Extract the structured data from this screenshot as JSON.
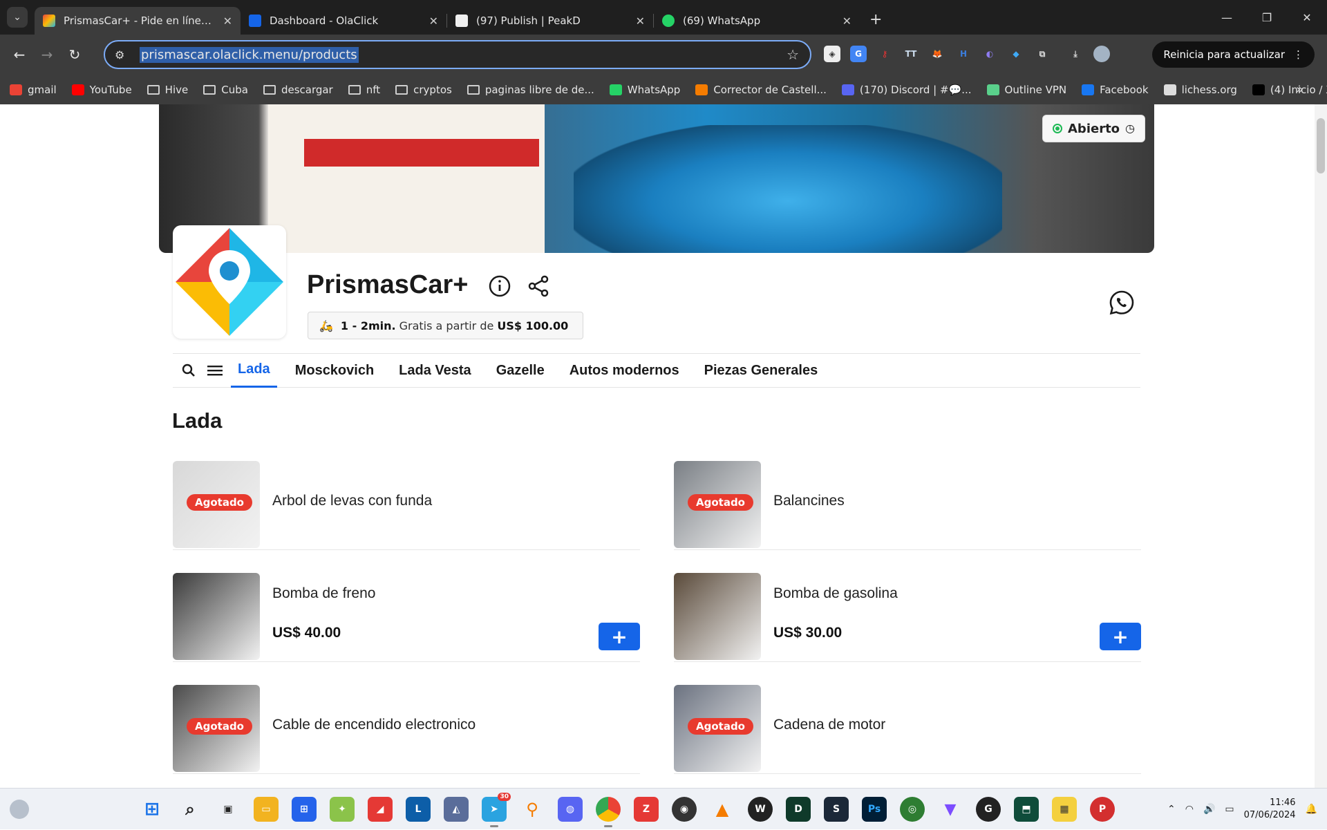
{
  "browser": {
    "tabs": [
      {
        "title": "PrismasCar+ - Pide en línea. Me",
        "favicon_color": "#e8453c",
        "active": true
      },
      {
        "title": "Dashboard - OlaClick",
        "favicon_color": "#1565e8",
        "active": false
      },
      {
        "title": "(97) Publish | PeakD",
        "favicon_color": "#f0f0f0",
        "active": false
      },
      {
        "title": "(69) WhatsApp",
        "favicon_color": "#25d366",
        "active": false
      }
    ],
    "address": "prismascar.olaclick.menu/products",
    "update_button": "Reinicia para actualizar",
    "bookmarks": [
      {
        "label": "gmail",
        "icon": "gmail-icon",
        "type": "icon",
        "color": "#ea4335"
      },
      {
        "label": "YouTube",
        "icon": "youtube-icon",
        "type": "icon",
        "color": "#ff0000"
      },
      {
        "label": "Hive",
        "icon": "folder-icon",
        "type": "folder"
      },
      {
        "label": "Cuba",
        "icon": "folder-icon",
        "type": "folder"
      },
      {
        "label": "descargar",
        "icon": "folder-icon",
        "type": "folder"
      },
      {
        "label": "nft",
        "icon": "folder-icon",
        "type": "folder"
      },
      {
        "label": "cryptos",
        "icon": "folder-icon",
        "type": "folder"
      },
      {
        "label": "paginas libre de de...",
        "icon": "folder-icon",
        "type": "folder"
      },
      {
        "label": "WhatsApp",
        "icon": "whatsapp-icon",
        "type": "icon",
        "color": "#25d366"
      },
      {
        "label": "Corrector de Castell...",
        "icon": "check-icon",
        "type": "icon",
        "color": "#f57c00"
      },
      {
        "label": "(170) Discord | #💬...",
        "icon": "discord-icon",
        "type": "icon",
        "color": "#5865f2"
      },
      {
        "label": "Outline VPN",
        "icon": "outline-icon",
        "type": "icon",
        "color": "#5ad08b"
      },
      {
        "label": "Facebook",
        "icon": "facebook-icon",
        "type": "icon",
        "color": "#1877f2"
      },
      {
        "label": "lichess.org",
        "icon": "lichess-icon",
        "type": "icon",
        "color": "#dddddd"
      },
      {
        "label": "(4) Inicio / X",
        "icon": "x-icon",
        "type": "icon",
        "color": "#000000"
      }
    ]
  },
  "store": {
    "name": "PrismasCar+",
    "status": "Abierto",
    "delivery_time": "1 - 2min.",
    "delivery_text": "Gratis a partir de",
    "delivery_min": "US$ 100.00"
  },
  "categories": [
    "Lada",
    "Mosckovich",
    "Lada Vesta",
    "Gazelle",
    "Autos modernos",
    "Piezas Generales"
  ],
  "active_category": "Lada",
  "section_title": "Lada",
  "products": [
    {
      "name": "Arbol de levas con funda",
      "price": "",
      "badge": "Agotado",
      "thumb_color": "#d8d8d8"
    },
    {
      "name": "Balancines",
      "price": "",
      "badge": "Agotado",
      "thumb_color": "#7a7f85"
    },
    {
      "name": "Bomba de freno",
      "price": "US$ 40.00",
      "badge": "",
      "thumb_color": "#3a3a3a"
    },
    {
      "name": "Bomba de gasolina",
      "price": "US$ 30.00",
      "badge": "",
      "thumb_color": "#5a4a3a"
    },
    {
      "name": "Cable de encendido electronico",
      "price": "",
      "badge": "Agotado",
      "thumb_color": "#4b4b4b"
    },
    {
      "name": "Cadena de motor",
      "price": "",
      "badge": "Agotado",
      "thumb_color": "#6b7280"
    }
  ],
  "taskbar": {
    "time": "11:46",
    "date": "07/06/2024",
    "telegram_badge": "30"
  }
}
